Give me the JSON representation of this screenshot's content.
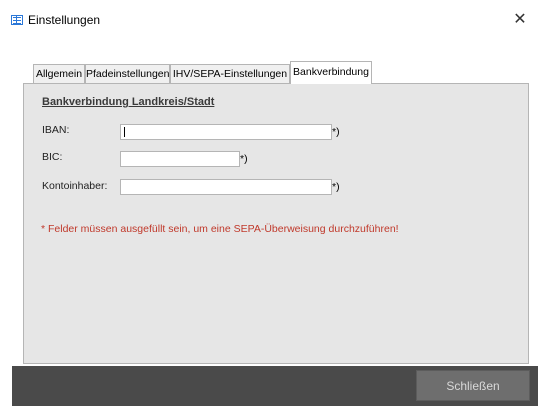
{
  "window": {
    "title": "Einstellungen",
    "close_glyph": "✕"
  },
  "tabs": [
    {
      "label": "Allgemein",
      "active": false
    },
    {
      "label": "Pfadeinstellungen",
      "active": false
    },
    {
      "label": "IHV/SEPA-Einstellungen",
      "active": false
    },
    {
      "label": "Bankverbindung",
      "active": true
    }
  ],
  "bank": {
    "heading": "Bankverbindung Landkreis/Stadt",
    "fields": [
      {
        "label": "IBAN:",
        "value": "",
        "required_mark": "*)"
      },
      {
        "label": "BIC:",
        "value": "",
        "required_mark": "*)"
      },
      {
        "label": "Kontoinhaber:",
        "value": "",
        "required_mark": "*)"
      }
    ],
    "notice": "* Felder müssen ausgefüllt sein, um eine SEPA-Überweisung durchzuführen!"
  },
  "footer": {
    "close_button": "Schließen"
  },
  "colors": {
    "panel": "#e6e6e6",
    "notice": "#c0392b",
    "footer": "#4a4a4a",
    "accent": "#2b78d8"
  }
}
